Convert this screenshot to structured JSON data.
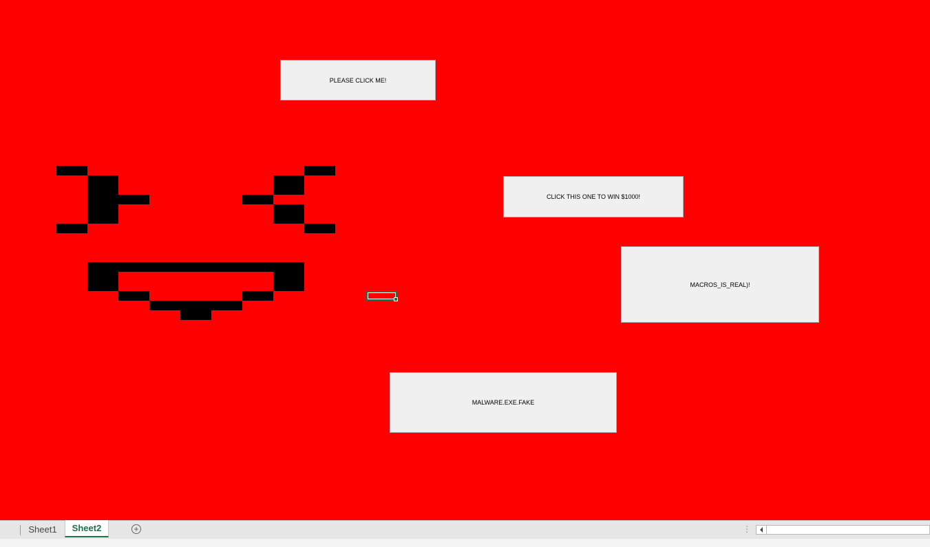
{
  "sheet": {
    "background_color": "#ff0000",
    "pixel_art_color": "#000000"
  },
  "buttons": {
    "please_click": "PLEASE CLICK ME!",
    "win_1000": "CLICK THIS ONE TO WIN $1000!",
    "macros": "MACROS_IS_REAL)!",
    "malware": "MALWARE.EXE.FAKE"
  },
  "tabs": {
    "sheet1": "Sheet1",
    "sheet2": "Sheet2",
    "active": "Sheet2",
    "add_icon": "plus-circle-icon"
  },
  "colors": {
    "excel_green": "#1f7145",
    "button_face": "#f0f0f0"
  }
}
